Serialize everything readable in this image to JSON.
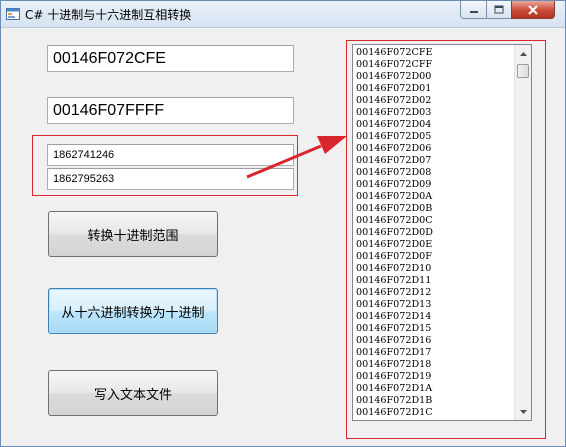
{
  "window": {
    "title": "C# 十进制与十六进制互相转换",
    "icon": "csharp-form-icon"
  },
  "inputs": {
    "hex_start": "00146F072CFE",
    "hex_end": "00146F07FFFF",
    "dec_start": "1862741246",
    "dec_end": "1862795263"
  },
  "buttons": {
    "convert_range": "转换十进制范围",
    "hex_to_dec": "从十六进制转换为十进制",
    "write_file": "写入文本文件"
  },
  "list": {
    "items": [
      "00146F072CFE",
      "00146F072CFF",
      "00146F072D00",
      "00146F072D01",
      "00146F072D02",
      "00146F072D03",
      "00146F072D04",
      "00146F072D05",
      "00146F072D06",
      "00146F072D07",
      "00146F072D08",
      "00146F072D09",
      "00146F072D0A",
      "00146F072D0B",
      "00146F072D0C",
      "00146F072D0D",
      "00146F072D0E",
      "00146F072D0F",
      "00146F072D10",
      "00146F072D11",
      "00146F072D12",
      "00146F072D13",
      "00146F072D14",
      "00146F072D15",
      "00146F072D16",
      "00146F072D17",
      "00146F072D18",
      "00146F072D19",
      "00146F072D1A",
      "00146F072D1B",
      "00146F072D1C"
    ]
  },
  "colors": {
    "annotation_red": "#d9262e"
  }
}
